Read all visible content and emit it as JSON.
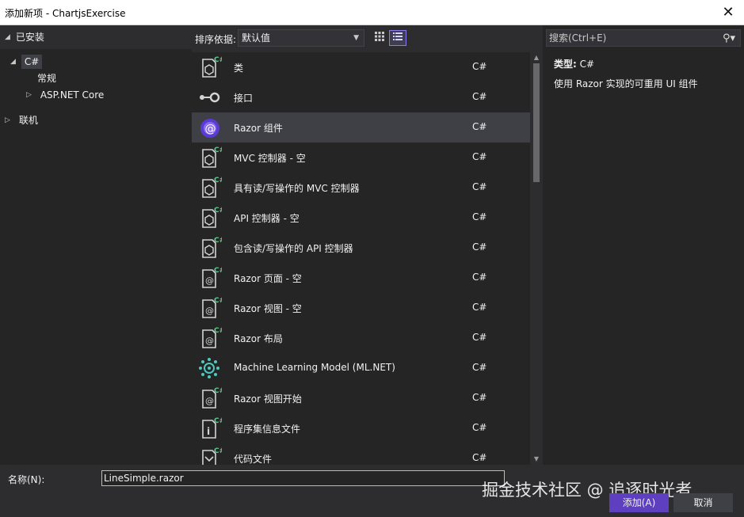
{
  "window": {
    "title": "添加新项 - ChartjsExercise",
    "close_glyph": "✕"
  },
  "left_tree": {
    "installed": "已安装",
    "csharp": "C#",
    "general": "常规",
    "aspnet_core": "ASP.NET Core",
    "online": "联机"
  },
  "toolbar": {
    "sort_label": "排序依据:",
    "sort_value": "默认值",
    "grid_view_icon": "grid-icon",
    "list_view_icon": "list-icon"
  },
  "templates": [
    {
      "name": "类",
      "lang": "C#",
      "icon": "class-icon"
    },
    {
      "name": "接口",
      "lang": "C#",
      "icon": "interface-icon"
    },
    {
      "name": "Razor 组件",
      "lang": "C#",
      "icon": "razor-component-icon",
      "selected": true
    },
    {
      "name": "MVC 控制器 - 空",
      "lang": "C#",
      "icon": "controller-icon"
    },
    {
      "name": "具有读/写操作的 MVC 控制器",
      "lang": "C#",
      "icon": "controller-icon"
    },
    {
      "name": "API 控制器 - 空",
      "lang": "C#",
      "icon": "controller-icon"
    },
    {
      "name": "包含读/写操作的 API 控制器",
      "lang": "C#",
      "icon": "controller-icon"
    },
    {
      "name": "Razor 页面 - 空",
      "lang": "C#",
      "icon": "razor-page-icon"
    },
    {
      "name": "Razor 视图 - 空",
      "lang": "C#",
      "icon": "razor-page-icon"
    },
    {
      "name": "Razor 布局",
      "lang": "C#",
      "icon": "razor-page-icon"
    },
    {
      "name": "Machine Learning Model (ML.NET)",
      "lang": "C#",
      "icon": "ml-model-icon"
    },
    {
      "name": "Razor 视图开始",
      "lang": "C#",
      "icon": "razor-page-icon"
    },
    {
      "name": "程序集信息文件",
      "lang": "C#",
      "icon": "assembly-info-icon"
    },
    {
      "name": "代码文件",
      "lang": "C#",
      "icon": "code-file-icon"
    }
  ],
  "details": {
    "search_placeholder": "搜索(Ctrl+E)",
    "type_label": "类型:",
    "type_value": "C#",
    "description": "使用 Razor 实现的可重用 UI 组件"
  },
  "bottom": {
    "name_label": "名称(N):",
    "name_value": "LineSimple.razor",
    "add_button": "添加(A)",
    "cancel_button": "取消",
    "watermark": "掘金技术社区 @ 追逐时光者"
  },
  "colors": {
    "accent": "#5d3fbf",
    "csharp_badge": "#57d08a",
    "background": "#252526",
    "selection": "#3f3f46"
  }
}
